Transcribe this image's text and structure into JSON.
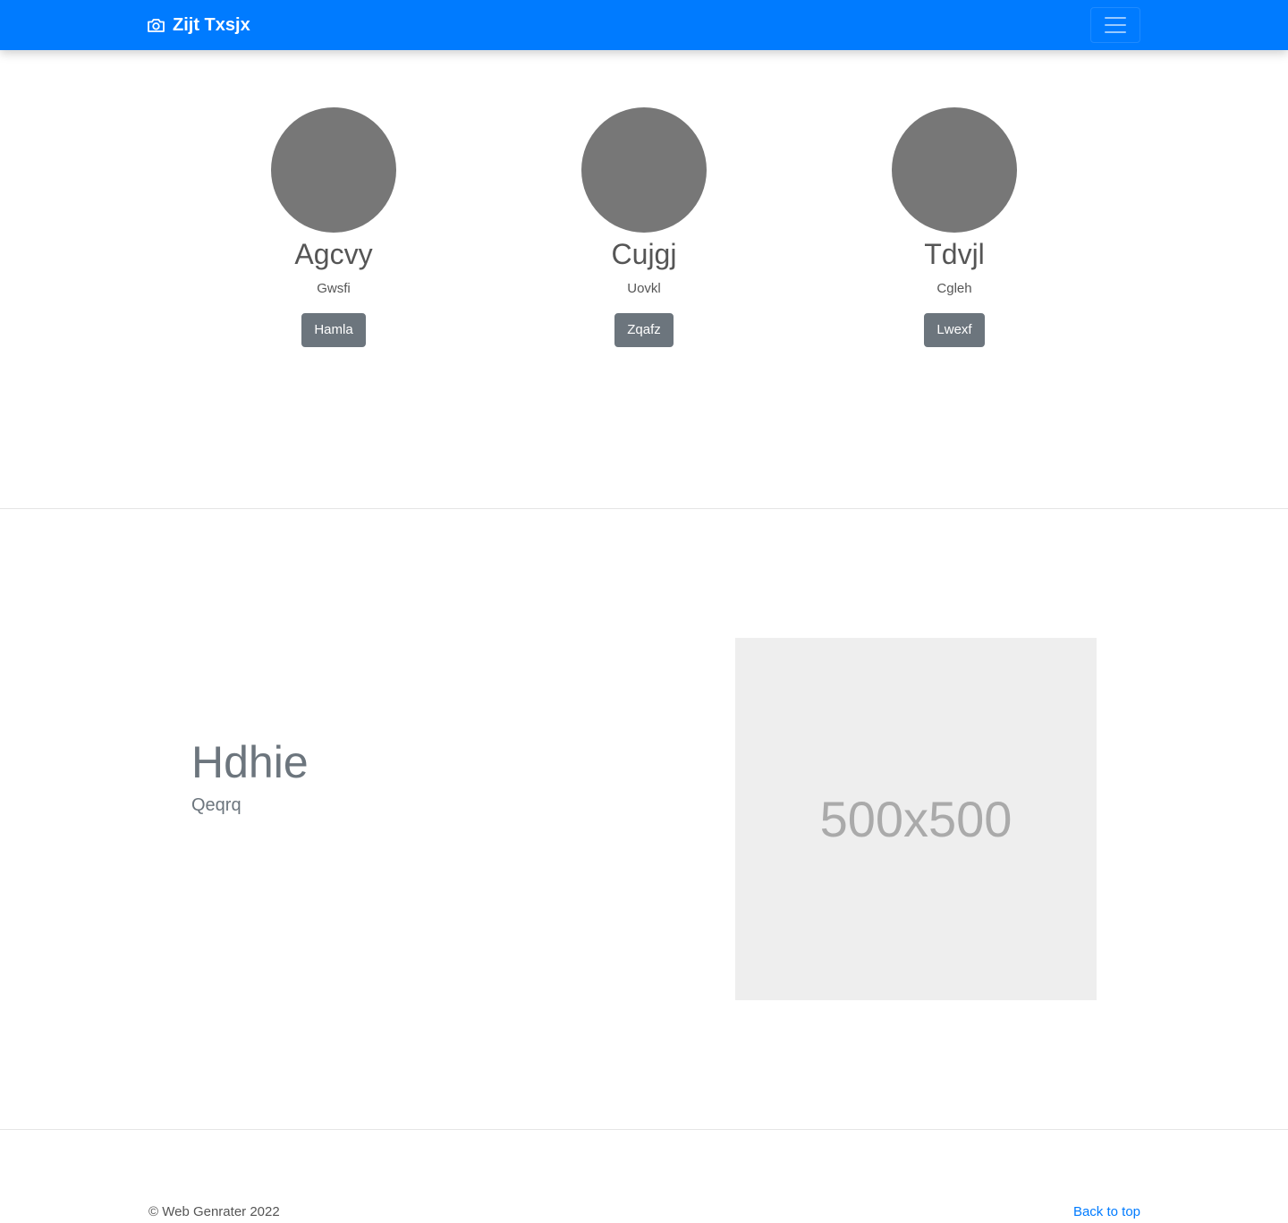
{
  "navbar": {
    "brand": "Zijt Txsjx",
    "brand_icon": "camera-icon",
    "toggler_icon": "hamburger-icon",
    "color": "#007bff"
  },
  "team": [
    {
      "name": "Agcvy",
      "subtitle": "Gwsfi",
      "button": "Hamla"
    },
    {
      "name": "Cujgj",
      "subtitle": "Uovkl",
      "button": "Zqafz"
    },
    {
      "name": "Tdvjl",
      "subtitle": "Cgleh",
      "button": "Lwexf"
    }
  ],
  "feature": {
    "heading": "Hdhie",
    "lead": "Qeqrq",
    "image_placeholder": "500x500"
  },
  "footer": {
    "copyright": "© Web Genrater 2022",
    "back_to_top": "Back to top"
  }
}
